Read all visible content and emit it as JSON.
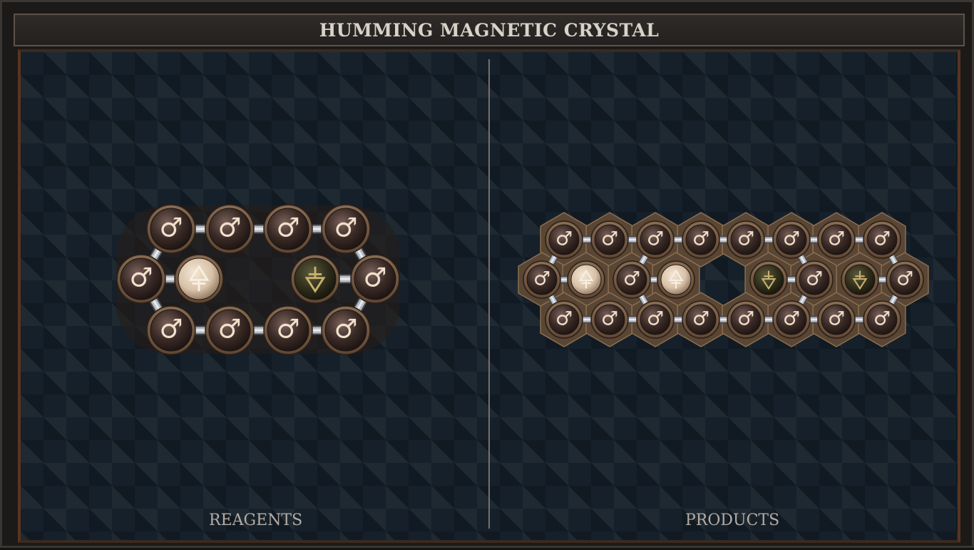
{
  "window": {
    "title": "HUMMING MAGNETIC CRYSTAL"
  },
  "panels": {
    "reagents": {
      "label": "REAGENTS"
    },
    "products": {
      "label": "PRODUCTS"
    }
  },
  "glyphs": {
    "male": "♂"
  },
  "colors": {
    "orb_dark": "#3a2a26",
    "orb_light": "#e0cdb8",
    "orb_olive": "#3a3a22",
    "rim": "#a98a68",
    "symbol_light": "#f0e0cc",
    "symbol_gold": "#c8b070"
  },
  "molecules": {
    "reagent": {
      "atoms": [
        {
          "type": "mars"
        },
        {
          "type": "mars"
        },
        {
          "type": "mars"
        },
        {
          "type": "mars"
        },
        {
          "type": "mars"
        },
        {
          "type": "salt_up"
        },
        {
          "type": "salt_down"
        },
        {
          "type": "mars"
        },
        {
          "type": "mars"
        },
        {
          "type": "mars"
        },
        {
          "type": "mars"
        },
        {
          "type": "mars"
        }
      ]
    },
    "product": {
      "atoms": [
        {
          "type": "mars"
        },
        {
          "type": "mars"
        },
        {
          "type": "mars"
        },
        {
          "type": "mars"
        },
        {
          "type": "mars"
        },
        {
          "type": "mars"
        },
        {
          "type": "mars"
        },
        {
          "type": "mars"
        },
        {
          "type": "mars"
        },
        {
          "type": "salt_up"
        },
        {
          "type": "mars"
        },
        {
          "type": "salt_up"
        },
        {
          "type": "salt_down"
        },
        {
          "type": "mars"
        },
        {
          "type": "salt_down"
        },
        {
          "type": "mars"
        },
        {
          "type": "mars"
        },
        {
          "type": "mars"
        },
        {
          "type": "mars"
        },
        {
          "type": "mars"
        },
        {
          "type": "mars"
        },
        {
          "type": "mars"
        },
        {
          "type": "mars"
        },
        {
          "type": "mars"
        }
      ]
    }
  }
}
